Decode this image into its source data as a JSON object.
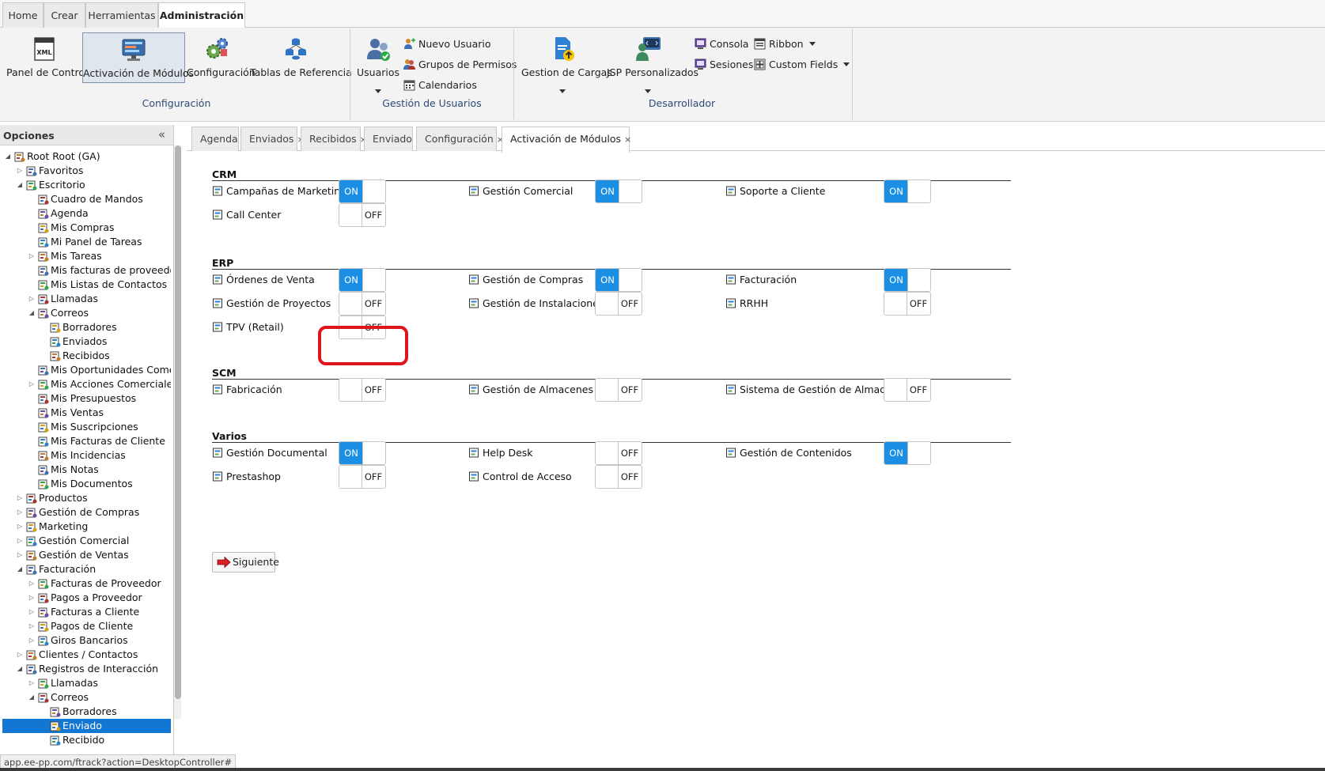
{
  "ribbon": {
    "tabs": [
      {
        "label": "Home",
        "active": false
      },
      {
        "label": "Crear",
        "active": false
      },
      {
        "label": "Herramientas",
        "active": false
      },
      {
        "label": "Administración",
        "active": true
      }
    ],
    "groups": [
      {
        "title": "Configuración",
        "buttons": [
          {
            "label": "Panel de Control",
            "icon": "xml-file-icon",
            "active": false
          },
          {
            "label": "Activación de Módulos",
            "icon": "monitor-modules-icon",
            "active": true
          },
          {
            "label": "Configuración",
            "icon": "gears-icon",
            "active": false
          },
          {
            "label": "Tablas de Referencia",
            "icon": "database-tables-icon",
            "active": false
          }
        ]
      },
      {
        "title": "Gestión de Usuarios",
        "buttons": [
          {
            "label": "Usuarios",
            "icon": "users-icon",
            "dropdown": true
          }
        ],
        "small": [
          {
            "label": "Nuevo Usuario",
            "icon": "new-user-icon"
          },
          {
            "label": "Grupos de Permisos",
            "icon": "permission-groups-icon"
          },
          {
            "label": "Calendarios",
            "icon": "calendar-icon"
          }
        ]
      },
      {
        "title": "Desarrollador",
        "buttons": [
          {
            "label": "Gestion de Cargas",
            "icon": "upload-document-icon",
            "dropdown": true
          },
          {
            "label": "JSP Personalizados",
            "icon": "developer-icon",
            "dropdown": true
          }
        ],
        "small": [
          {
            "label": "Consola",
            "icon": "console-icon"
          },
          {
            "label": "Sesiones",
            "icon": "sessions-icon"
          },
          {
            "label": "Ribbon",
            "icon": "ribbon-icon",
            "dropdown": true
          },
          {
            "label": "Custom Fields",
            "icon": "custom-fields-icon",
            "dropdown": true
          }
        ]
      }
    ]
  },
  "sidebar": {
    "title": "Opciones",
    "collapse_glyph": "«",
    "status_url": "app.ee-pp.com/ftrack?action=DesktopController#",
    "tree": [
      {
        "label": "Root Root (GA)",
        "level": 0,
        "toggle": "expanded",
        "icon": "root-user-icon"
      },
      {
        "label": "Favoritos",
        "level": 1,
        "toggle": "collapsed",
        "icon": "star-icon"
      },
      {
        "label": "Escritorio",
        "level": 1,
        "toggle": "expanded",
        "icon": "desktop-icon"
      },
      {
        "label": "Cuadro de Mandos",
        "level": 2,
        "toggle": "none",
        "icon": "dashboard-icon"
      },
      {
        "label": "Agenda",
        "level": 2,
        "toggle": "none",
        "icon": "agenda-icon"
      },
      {
        "label": "Mis Compras",
        "level": 2,
        "toggle": "none",
        "icon": "purchases-icon"
      },
      {
        "label": "Mi Panel de Tareas",
        "level": 2,
        "toggle": "none",
        "icon": "task-board-icon"
      },
      {
        "label": "Mis Tareas",
        "level": 2,
        "toggle": "collapsed",
        "icon": "tasks-icon"
      },
      {
        "label": "Mis facturas de proveedor",
        "level": 2,
        "toggle": "none",
        "icon": "supplier-invoice-icon"
      },
      {
        "label": "Mis Listas de Contactos",
        "level": 2,
        "toggle": "none",
        "icon": "contact-list-icon"
      },
      {
        "label": "Llamadas",
        "level": 2,
        "toggle": "collapsed",
        "icon": "phone-icon"
      },
      {
        "label": "Correos",
        "level": 2,
        "toggle": "expanded",
        "icon": "mail-icon"
      },
      {
        "label": "Borradores",
        "level": 3,
        "toggle": "none",
        "icon": "draft-icon"
      },
      {
        "label": "Enviados",
        "level": 3,
        "toggle": "none",
        "icon": "sent-mail-icon"
      },
      {
        "label": "Recibidos",
        "level": 3,
        "toggle": "none",
        "icon": "received-mail-icon"
      },
      {
        "label": "Mis Oportunidades Comercia",
        "level": 2,
        "toggle": "none",
        "icon": "opportunities-icon"
      },
      {
        "label": "Mis Acciones Comerciales",
        "level": 2,
        "toggle": "collapsed",
        "icon": "sales-actions-icon"
      },
      {
        "label": "Mis Presupuestos",
        "level": 2,
        "toggle": "none",
        "icon": "budget-icon"
      },
      {
        "label": "Mis Ventas",
        "level": 2,
        "toggle": "none",
        "icon": "sales-icon"
      },
      {
        "label": "Mis Suscripciones",
        "level": 2,
        "toggle": "none",
        "icon": "subscriptions-icon"
      },
      {
        "label": "Mis Facturas de Cliente",
        "level": 2,
        "toggle": "none",
        "icon": "client-invoice-icon"
      },
      {
        "label": "Mis Incidencias",
        "level": 2,
        "toggle": "none",
        "icon": "incidents-icon"
      },
      {
        "label": "Mis Notas",
        "level": 2,
        "toggle": "none",
        "icon": "notes-icon"
      },
      {
        "label": "Mis Documentos",
        "level": 2,
        "toggle": "none",
        "icon": "documents-icon"
      },
      {
        "label": "Productos",
        "level": 1,
        "toggle": "collapsed",
        "icon": "products-icon"
      },
      {
        "label": "Gestión de Compras",
        "level": 1,
        "toggle": "collapsed",
        "icon": "purchasing-icon"
      },
      {
        "label": "Marketing",
        "level": 1,
        "toggle": "collapsed",
        "icon": "marketing-icon"
      },
      {
        "label": "Gestión Comercial",
        "level": 1,
        "toggle": "collapsed",
        "icon": "commercial-icon"
      },
      {
        "label": "Gestión de Ventas",
        "level": 1,
        "toggle": "collapsed",
        "icon": "sales-management-icon"
      },
      {
        "label": "Facturación",
        "level": 1,
        "toggle": "expanded",
        "icon": "billing-icon"
      },
      {
        "label": "Facturas de Proveedor",
        "level": 2,
        "toggle": "collapsed",
        "icon": "supplier-invoice-icon"
      },
      {
        "label": "Pagos a Proveedor",
        "level": 2,
        "toggle": "collapsed",
        "icon": "supplier-payment-icon"
      },
      {
        "label": "Facturas a Cliente",
        "level": 2,
        "toggle": "collapsed",
        "icon": "client-invoice-icon"
      },
      {
        "label": "Pagos de Cliente",
        "level": 2,
        "toggle": "collapsed",
        "icon": "client-payment-icon"
      },
      {
        "label": "Giros Bancarios",
        "level": 2,
        "toggle": "collapsed",
        "icon": "bank-transfer-icon"
      },
      {
        "label": "Clientes / Contactos",
        "level": 1,
        "toggle": "collapsed",
        "icon": "clients-icon"
      },
      {
        "label": "Registros de Interacción",
        "level": 1,
        "toggle": "expanded",
        "icon": "interaction-log-icon"
      },
      {
        "label": "Llamadas",
        "level": 2,
        "toggle": "collapsed",
        "icon": "phone-icon"
      },
      {
        "label": "Correos",
        "level": 2,
        "toggle": "expanded",
        "icon": "mail-icon"
      },
      {
        "label": "Borradores",
        "level": 3,
        "toggle": "none",
        "icon": "draft-icon"
      },
      {
        "label": "Enviado",
        "level": 3,
        "toggle": "none",
        "icon": "sent-mail-icon",
        "selected": true
      },
      {
        "label": "Recibido",
        "level": 3,
        "toggle": "none",
        "icon": "received-mail-icon"
      }
    ]
  },
  "content_tabs": [
    {
      "label": "Agenda",
      "closable": false,
      "active": false
    },
    {
      "label": "Enviados",
      "closable": true,
      "active": false
    },
    {
      "label": "Recibidos",
      "closable": true,
      "active": false
    },
    {
      "label": "Enviado",
      "closable": true,
      "active": false
    },
    {
      "label": "Configuración",
      "closable": true,
      "active": false
    },
    {
      "label": "Activación de Módulos",
      "closable": true,
      "active": true
    }
  ],
  "close_glyph": "×",
  "toggle_labels": {
    "on": "ON",
    "off": "OFF"
  },
  "colors": {
    "accent": "#1a8fe3",
    "selected": "#1277d2",
    "highlight": "#e0141b"
  },
  "sections": [
    {
      "title": "CRM",
      "modules": [
        {
          "label": "Campañas de Marketing",
          "icon": "campaign-icon",
          "on": true
        },
        {
          "label": "Gestión Comercial",
          "icon": "commercial-icon",
          "on": true
        },
        {
          "label": "Soporte a Cliente",
          "icon": "support-icon",
          "on": true
        },
        {
          "label": "Call Center",
          "icon": "headset-icon",
          "on": false
        }
      ]
    },
    {
      "title": "ERP",
      "modules": [
        {
          "label": "Órdenes de Venta",
          "icon": "sales-order-icon",
          "on": true
        },
        {
          "label": "Gestión de Compras",
          "icon": "purchasing-icon",
          "on": true
        },
        {
          "label": "Facturación",
          "icon": "billing-icon",
          "on": true
        },
        {
          "label": "Gestión de Proyectos",
          "icon": "projects-icon",
          "on": false
        },
        {
          "label": "Gestión de Instalaciones",
          "icon": "installations-icon",
          "on": false
        },
        {
          "label": "RRHH",
          "icon": "hr-icon",
          "on": false
        },
        {
          "label": "TPV (Retail)",
          "icon": "pos-icon",
          "on": false
        }
      ]
    },
    {
      "title": "SCM",
      "modules": [
        {
          "label": "Fabricación",
          "icon": "factory-icon",
          "on": false
        },
        {
          "label": "Gestión de Almacenes",
          "icon": "warehouse-icon",
          "on": false
        },
        {
          "label": "Sistema de Gestión de Almacén",
          "icon": "barcode-icon",
          "on": false
        }
      ]
    },
    {
      "title": "Varios",
      "modules": [
        {
          "label": "Gestión Documental",
          "icon": "document-management-icon",
          "on": true
        },
        {
          "label": "Help Desk",
          "icon": "helpdesk-icon",
          "on": false
        },
        {
          "label": "Gestión de Contenidos",
          "icon": "content-icon",
          "on": true
        },
        {
          "label": "Prestashop",
          "icon": "prestashop-icon",
          "on": false
        },
        {
          "label": "Control de Acceso",
          "icon": "access-control-icon",
          "on": false
        }
      ]
    }
  ],
  "next_button": {
    "label": "Siguiente",
    "icon": "arrow-right-icon"
  }
}
